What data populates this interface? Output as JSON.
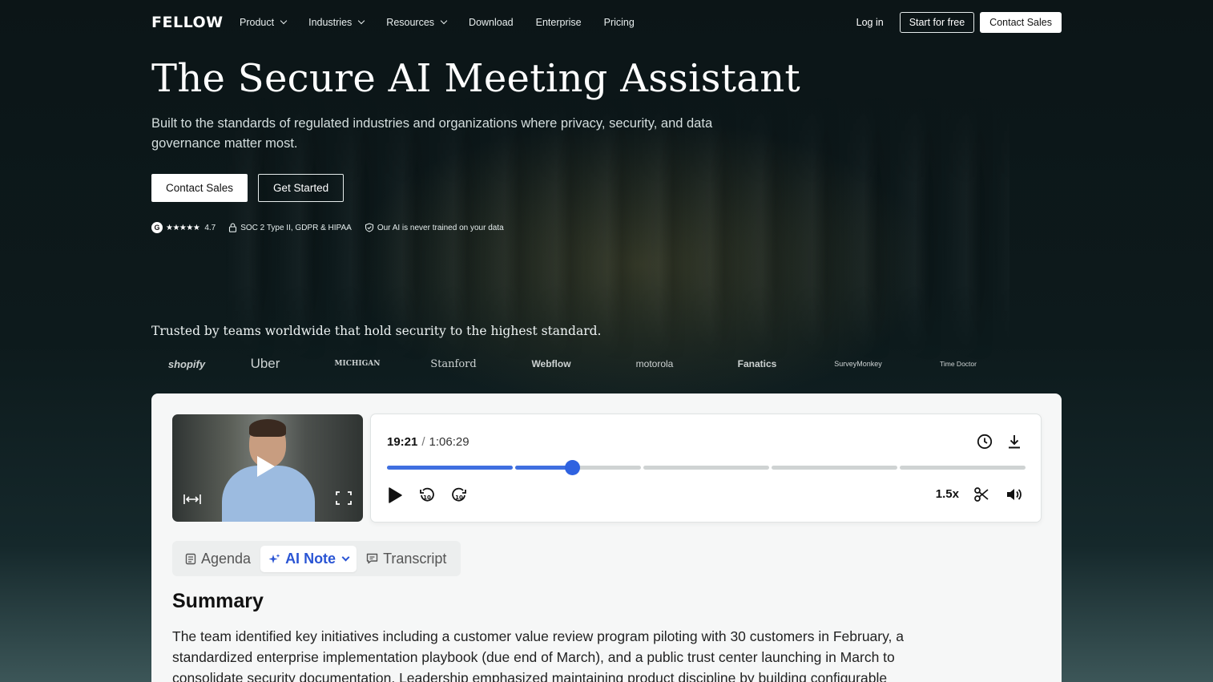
{
  "nav": {
    "logo": "FELLOW",
    "links": [
      {
        "label": "Product",
        "dropdown": true
      },
      {
        "label": "Industries",
        "dropdown": true
      },
      {
        "label": "Resources",
        "dropdown": true
      },
      {
        "label": "Download",
        "dropdown": false
      },
      {
        "label": "Enterprise",
        "dropdown": false
      },
      {
        "label": "Pricing",
        "dropdown": false
      }
    ],
    "login": "Log in",
    "start_free": "Start for free",
    "contact_sales": "Contact Sales"
  },
  "hero": {
    "title": "The Secure AI Meeting Assistant",
    "subtitle": "Built to the standards of regulated industries and organizations where privacy, security, and data governance matter most.",
    "primary_button": "Contact Sales",
    "secondary_button": "Get Started",
    "rating_logo": "G",
    "rating_stars": "★★★★★",
    "rating_value": "4.7",
    "compliance": "SOC 2 Type II, GDPR & HIPAA",
    "ai_note": "Our AI is never trained on your data"
  },
  "trusted": {
    "headline": "Trusted by teams worldwide that hold security to the highest standard.",
    "logos": [
      "shopify",
      "Uber",
      "MICHIGAN",
      "Stanford",
      "Webflow",
      "motorola",
      "Fanatics",
      "SurveyMonkey",
      "Time Doctor"
    ]
  },
  "player": {
    "current_time": "19:21",
    "separator": "/",
    "total_time": "1:06:29",
    "progress": 0.29,
    "speed": "1.5x"
  },
  "tabs": [
    {
      "label": "Agenda",
      "icon": "agenda-icon",
      "active": false
    },
    {
      "label": "AI Note",
      "icon": "sparkle-icon",
      "active": true
    },
    {
      "label": "Transcript",
      "icon": "transcript-icon",
      "active": false
    }
  ],
  "summary": {
    "title": "Summary",
    "text": "The team identified key initiatives including a customer value review program piloting with 30 customers in February, a standardized enterprise implementation playbook (due end of March), and a public trust center launching in March to consolidate security documentation. Leadership emphasized maintaining product discipline by building configurable"
  },
  "colors": {
    "accent": "#2f62e0",
    "background": "#0d1618",
    "card": "#f6f7f7"
  }
}
